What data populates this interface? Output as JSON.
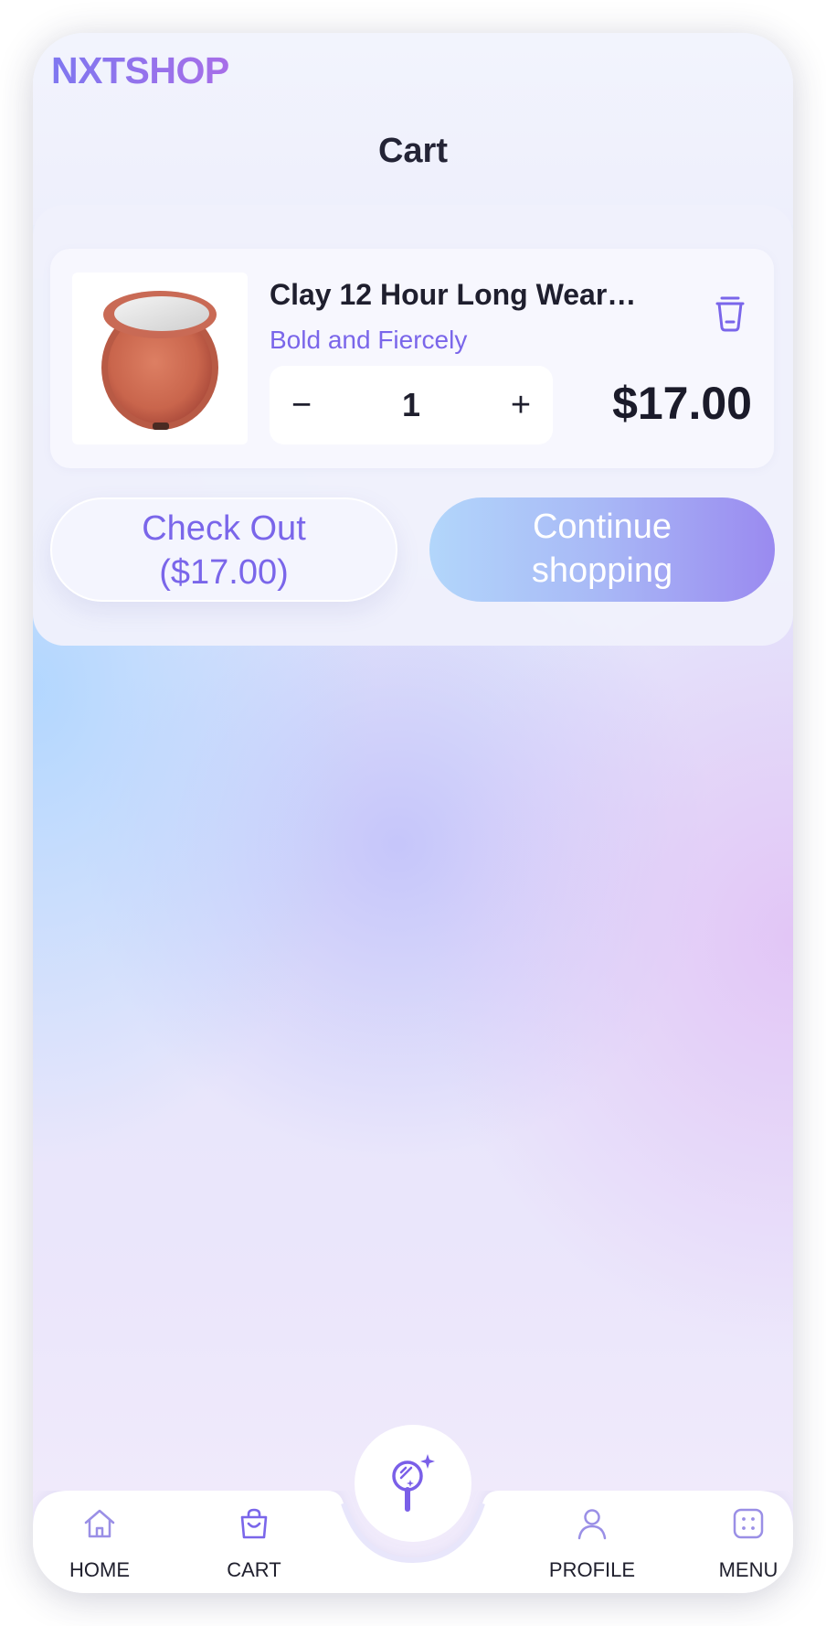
{
  "app": {
    "logo": "NXTSHOP",
    "title": "Cart"
  },
  "cart": {
    "items": [
      {
        "name": "Clay 12 Hour Long Wear…",
        "shade": "Bold and Fiercely",
        "quantity": "1",
        "price": "$17.00",
        "image_icon": "blush-compact-image"
      }
    ],
    "checkout": {
      "line1": "Check Out",
      "line2": "($17.00)"
    },
    "continue": {
      "line1": "Continue",
      "line2": "shopping"
    }
  },
  "stepper": {
    "minus": "−",
    "plus": "+"
  },
  "nav": {
    "items": [
      {
        "label": "HOME",
        "icon": "home-icon"
      },
      {
        "label": "CART",
        "icon": "shopping-bag-icon"
      },
      {
        "label": "PROFILE",
        "icon": "user-icon"
      },
      {
        "label": "MENU",
        "icon": "grid-dots-icon"
      }
    ],
    "center_icon": "magic-mirror-icon"
  },
  "colors": {
    "accent": "#7a66ea",
    "text": "#1f1f2e",
    "continue_gradient_start": "#b2d6fb",
    "continue_gradient_end": "#9a8af0"
  }
}
